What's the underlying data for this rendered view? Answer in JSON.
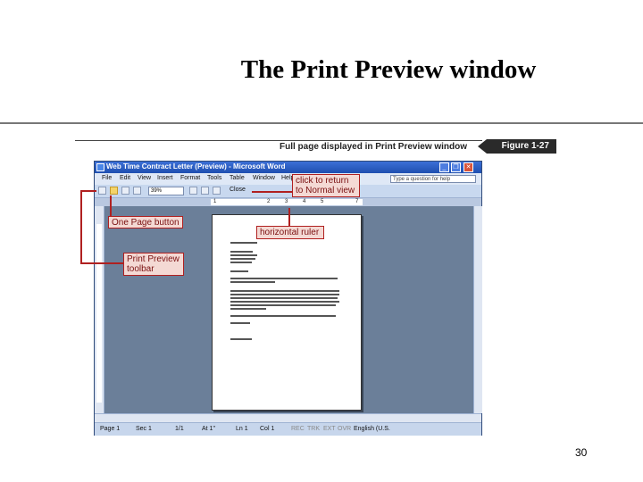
{
  "slide": {
    "title": "The Print Preview window",
    "page_number": "30"
  },
  "figure": {
    "caption": "Full page displayed in Print Preview window",
    "tag": "Figure 1-27"
  },
  "window": {
    "title": "Web Time Contract Letter (Preview) - Microsoft Word",
    "menu": [
      "File",
      "Edit",
      "View",
      "Insert",
      "Format",
      "Tools",
      "Table",
      "Window",
      "Help"
    ],
    "help_placeholder": "Type a question for help",
    "zoom": "39%",
    "close_label": "Close",
    "ruler_numbers": [
      "1",
      "2",
      "3",
      "4",
      "5",
      "7"
    ],
    "status": [
      "Page 1",
      "Sec 1",
      "1/1",
      "At 1\"",
      "Ln 1",
      "Col 1",
      "REC",
      "TRK",
      "EXT",
      "OVR",
      "English (U.S."
    ]
  },
  "callouts": {
    "close": "click to return to Normal view",
    "one_page": "One Page button",
    "ruler": "horizontal ruler",
    "toolbar": "Print Preview toolbar"
  },
  "colors": {
    "callout_border": "#b02020",
    "title_bar": "#1f4fb0"
  }
}
